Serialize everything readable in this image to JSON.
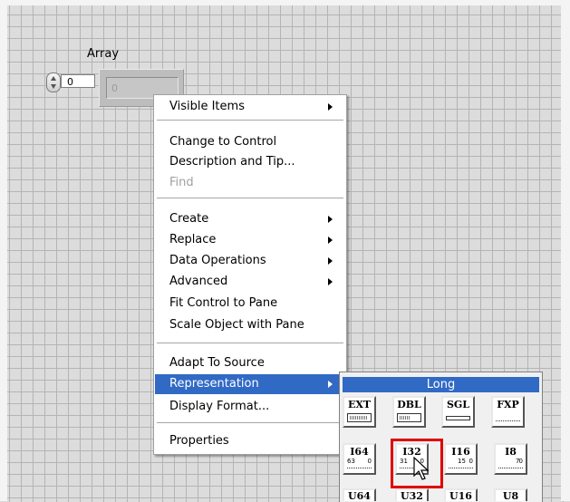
{
  "array": {
    "label": "Array",
    "index_value": "0",
    "element_value": "0"
  },
  "context_menu": {
    "items": [
      {
        "label": "Visible Items",
        "submenu": true
      },
      {
        "label": "Change to Control"
      },
      {
        "label": "Description and Tip..."
      },
      {
        "label": "Find",
        "disabled": true
      },
      {
        "label": "Create",
        "submenu": true
      },
      {
        "label": "Replace",
        "submenu": true
      },
      {
        "label": "Data Operations",
        "submenu": true
      },
      {
        "label": "Advanced",
        "submenu": true
      },
      {
        "label": "Fit Control to Pane"
      },
      {
        "label": "Scale Object with Pane"
      },
      {
        "label": "Adapt To Source"
      },
      {
        "label": "Representation",
        "submenu": true,
        "selected": true
      },
      {
        "label": "Display Format..."
      },
      {
        "label": "Properties"
      }
    ]
  },
  "representation_palette": {
    "title": "Long",
    "row1": [
      {
        "label": "EXT"
      },
      {
        "label": "DBL"
      },
      {
        "label": "SGL"
      },
      {
        "label": "FXP"
      }
    ],
    "row2": [
      {
        "label": "I64",
        "range_hi": "63",
        "range_lo": "0"
      },
      {
        "label": "I32",
        "range_hi": "31",
        "range_lo": "0",
        "highlighted": true
      },
      {
        "label": "I16",
        "range_hi": "15",
        "range_lo": "0"
      },
      {
        "label": "I8",
        "range_hi": "7",
        "range_lo": "0"
      }
    ],
    "row3_partial": [
      "U64",
      "U32",
      "U16",
      "U8"
    ]
  },
  "colors": {
    "selection": "#316ac5",
    "highlight_box": "#e00000",
    "grid": "#b4b4b4"
  }
}
